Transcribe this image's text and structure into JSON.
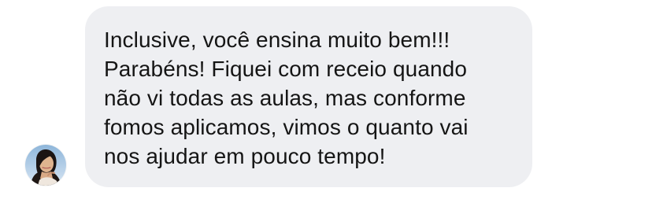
{
  "chat": {
    "sender_avatar": {
      "icon": "profile-photo-woman"
    },
    "message": {
      "lines": [
        "Inclusive, você ensina muito bem!!!",
        "Parabéns! Fiquei com receio quando",
        "não vi todas as aulas, mas conforme",
        "fomos aplicamos, vimos o quanto vai",
        "nos ajudar em pouco tempo!"
      ]
    }
  },
  "colors": {
    "bubble_background": "#eeeff2",
    "text": "#151515",
    "page_background": "#ffffff"
  }
}
